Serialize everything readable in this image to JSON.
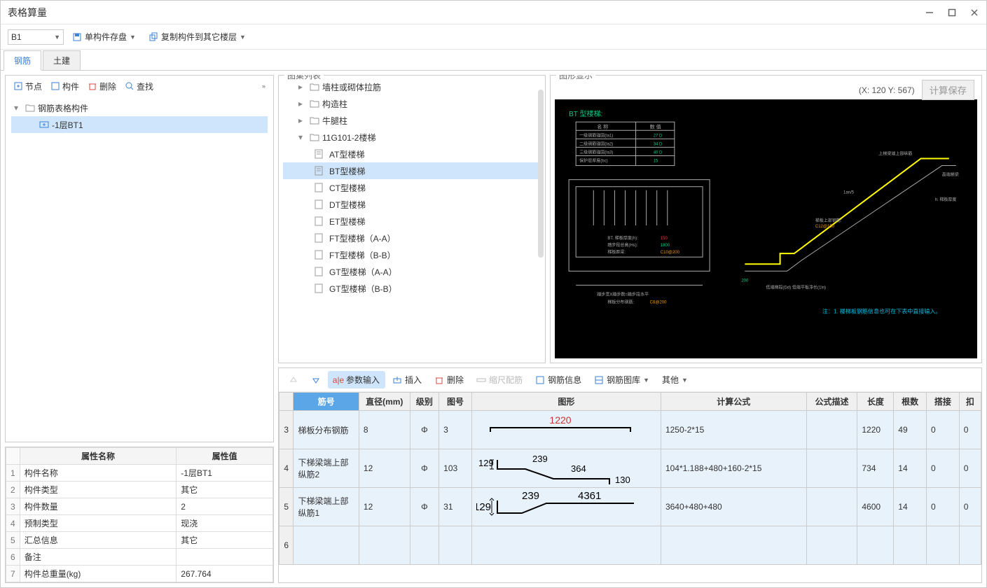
{
  "window": {
    "title": "表格算量"
  },
  "toolbar": {
    "combo_value": "B1",
    "save_label": "单构件存盘",
    "copy_label": "复制构件到其它楼层"
  },
  "tabs": {
    "rebar": "钢筋",
    "civil": "土建"
  },
  "left_toolbar": {
    "node": "节点",
    "component": "构件",
    "delete": "删除",
    "search": "查找"
  },
  "tree": {
    "root": "钢筋表格构件",
    "child": "-1层BT1"
  },
  "props": {
    "header_name": "属性名称",
    "header_value": "属性值",
    "rows": [
      {
        "n": "1",
        "name": "构件名称",
        "value": "-1层BT1"
      },
      {
        "n": "2",
        "name": "构件类型",
        "value": "其它"
      },
      {
        "n": "3",
        "name": "构件数量",
        "value": "2"
      },
      {
        "n": "4",
        "name": "预制类型",
        "value": "现浇"
      },
      {
        "n": "5",
        "name": "汇总信息",
        "value": "其它"
      },
      {
        "n": "6",
        "name": "备注",
        "value": ""
      },
      {
        "n": "7",
        "name": "构件总重量(kg)",
        "value": "267.764"
      }
    ]
  },
  "gallery": {
    "title": "图集列表",
    "items": {
      "a": "墙柱或砌体拉筋",
      "b": "构造柱",
      "c": "牛腿柱",
      "d": "11G101-2楼梯",
      "at": "AT型楼梯",
      "bt": "BT型楼梯",
      "ct": "CT型楼梯",
      "dt": "DT型楼梯",
      "et": "ET型楼梯",
      "ft_aa": "FT型楼梯（A-A）",
      "ft_bb": "FT型楼梯（B-B）",
      "gt_aa": "GT型楼梯（A-A）",
      "gt_bb": "GT型楼梯（B-B）"
    }
  },
  "graph": {
    "title": "图形显示",
    "coords": "(X: 120 Y: 567)",
    "calc_save": "计算保存",
    "stair_label": "BT 型楼梯:",
    "table_h1": "名 称",
    "table_h2": "数 值",
    "note": "注：1. 楼梯板钢筋信息也可在下表中直接输入。"
  },
  "bottom_toolbar": {
    "param_input": "参数输入",
    "insert": "插入",
    "delete": "删除",
    "scale": "缩尺配筋",
    "rebar_info": "钢筋信息",
    "rebar_lib": "钢筋图库",
    "other": "其他"
  },
  "grid": {
    "headers": {
      "no": "筋号",
      "dia": "直径(mm)",
      "grade": "级别",
      "drawing": "图号",
      "shape": "图形",
      "formula": "计算公式",
      "desc": "公式描述",
      "length": "长度",
      "count": "根数",
      "lap": "搭接",
      "loss": "扣"
    },
    "rows": [
      {
        "n": "3",
        "name": "梯板分布钢筋",
        "dia": "8",
        "grade": "Φ",
        "drawing": "3",
        "shape_vals": [
          "1220"
        ],
        "formula": "1250-2*15",
        "desc": "",
        "length": "1220",
        "count": "49",
        "lap": "0",
        "loss": "0"
      },
      {
        "n": "4",
        "name": "下梯梁端上部纵筋2",
        "dia": "12",
        "grade": "Φ",
        "drawing": "103",
        "shape_vals": [
          "129",
          "239",
          "364",
          "130"
        ],
        "formula": "104*1.188+480+160-2*15",
        "desc": "",
        "length": "734",
        "count": "14",
        "lap": "0",
        "loss": "0"
      },
      {
        "n": "5",
        "name": "下梯梁端上部纵筋1",
        "dia": "12",
        "grade": "Φ",
        "drawing": "31",
        "shape_vals": [
          "129",
          "239",
          "4361"
        ],
        "formula": "3640+480+480",
        "desc": "",
        "length": "4600",
        "count": "14",
        "lap": "0",
        "loss": "0"
      },
      {
        "n": "6",
        "name": "",
        "dia": "",
        "grade": "",
        "drawing": "",
        "shape_vals": [],
        "formula": "",
        "desc": "",
        "length": "",
        "count": "",
        "lap": "",
        "loss": ""
      }
    ]
  }
}
